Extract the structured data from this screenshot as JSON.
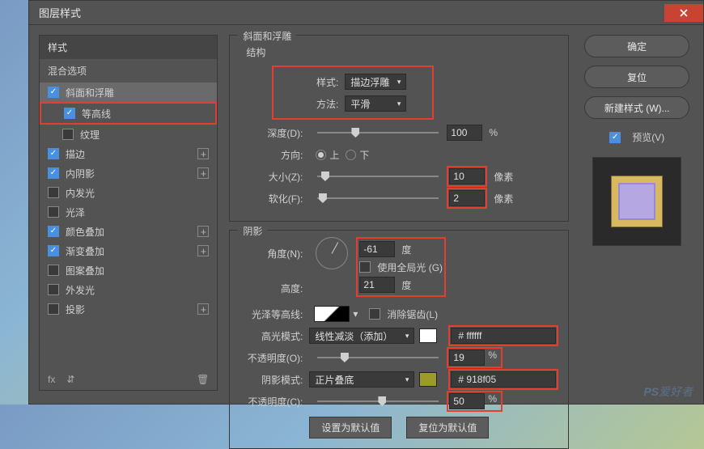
{
  "titlebar": {
    "title": "图层样式"
  },
  "left": {
    "header": "样式",
    "blend": "混合选项",
    "rows": [
      {
        "label": "斜面和浮雕",
        "checked": true,
        "selected": true
      },
      {
        "label": "等高线",
        "checked": true,
        "indent": true,
        "red": true
      },
      {
        "label": "纹理",
        "checked": false,
        "indent": true
      },
      {
        "label": "描边",
        "checked": true,
        "plus": true
      },
      {
        "label": "内阴影",
        "checked": true,
        "plus": true
      },
      {
        "label": "内发光",
        "checked": false
      },
      {
        "label": "光泽",
        "checked": false
      },
      {
        "label": "颜色叠加",
        "checked": true,
        "plus": true
      },
      {
        "label": "渐变叠加",
        "checked": true,
        "plus": true
      },
      {
        "label": "图案叠加",
        "checked": false
      },
      {
        "label": "外发光",
        "checked": false
      },
      {
        "label": "投影",
        "checked": false,
        "plus": true
      }
    ]
  },
  "center": {
    "group1": "斜面和浮雕",
    "sub1": "结构",
    "style_lbl": "样式:",
    "style_val": "描边浮雕",
    "method_lbl": "方法:",
    "method_val": "平滑",
    "depth_lbl": "深度(D):",
    "depth_val": "100",
    "pct": "%",
    "dir_lbl": "方向:",
    "dir_up": "上",
    "dir_down": "下",
    "size_lbl": "大小(Z):",
    "size_val": "10",
    "px": "像素",
    "soft_lbl": "软化(F):",
    "soft_val": "2",
    "group2": "阴影",
    "angle_lbl": "角度(N):",
    "angle_val": "-61",
    "deg": "度",
    "global_lbl": "使用全局光 (G)",
    "alt_lbl": "高度:",
    "alt_val": "21",
    "gloss_lbl": "光泽等高线:",
    "anti_lbl": "消除锯齿(L)",
    "hmode_lbl": "高光模式:",
    "hmode_val": "线性减淡（添加）",
    "hcolor": "#ffffff",
    "hhex": "ffffff",
    "hash": "#",
    "hopac_lbl": "不透明度(O):",
    "hopac_val": "19",
    "smode_lbl": "阴影模式:",
    "smode_val": "正片叠底",
    "scolor": "#9c9a28",
    "shex": "918f05",
    "sopac_lbl": "不透明度(C):",
    "sopac_val": "50",
    "btn_default": "设置为默认值",
    "btn_reset": "复位为默认值"
  },
  "right": {
    "ok": "确定",
    "cancel": "复位",
    "new": "新建样式 (W)...",
    "preview": "预览(V)"
  },
  "watermark": {
    "a": "PS",
    "b": "爱好者"
  }
}
